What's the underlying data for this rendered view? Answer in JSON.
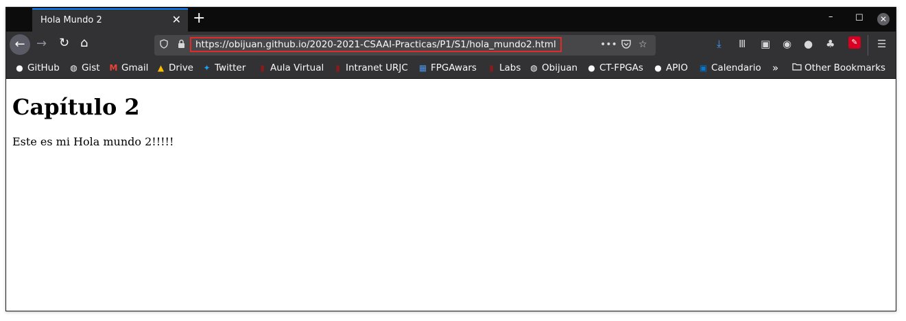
{
  "window": {
    "tab_title": "Hola Mundo 2",
    "tab_close": "✕",
    "new_tab": "+",
    "min": "–",
    "max": "☐",
    "close": "✕"
  },
  "navbar": {
    "back": "←",
    "forward": "→",
    "reload": "↻",
    "home": "⌂",
    "url": "https://obijuan.github.io/2020-2021-CSAAI-Practicas/P1/S1/hola_mundo2.html",
    "more": "•••",
    "pocket": "◙",
    "star": "☆"
  },
  "toolbar": {
    "download": "⤓",
    "library": "Ⅲ",
    "sidebar": "▣",
    "account": "◉",
    "github": "●",
    "gnome": "♣",
    "ext": "✎",
    "menu": "☰"
  },
  "bookmarks": [
    {
      "label": "GitHub",
      "icon": "github-icon"
    },
    {
      "label": "Gist",
      "icon": "globe-icon"
    },
    {
      "label": "Gmail",
      "icon": "gmail-icon"
    },
    {
      "label": "Drive",
      "icon": "drive-icon"
    },
    {
      "label": "Twitter",
      "icon": "twitter-icon"
    },
    {
      "label": "Aula Virtual",
      "icon": "urjc-icon"
    },
    {
      "label": "Intranet URJC",
      "icon": "urjc-icon"
    },
    {
      "label": "FPGAwars",
      "icon": "fpgawars-icon"
    },
    {
      "label": "Labs",
      "icon": "urjc-icon"
    },
    {
      "label": "Obijuan",
      "icon": "globe-icon"
    },
    {
      "label": "CT-FPGAs",
      "icon": "github-icon"
    },
    {
      "label": "APIO",
      "icon": "github-icon"
    },
    {
      "label": "Calendario",
      "icon": "outlook-icon"
    }
  ],
  "bookmarks_overflow": "»",
  "other_bookmarks": "Other Bookmarks",
  "page": {
    "heading": "Capítulo 2",
    "paragraph": "Este es mi Hola mundo 2!!!!!"
  },
  "colors": {
    "accent": "#0a84ff",
    "url_highlight": "#e22a2a",
    "chrome_dark": "#323234"
  }
}
